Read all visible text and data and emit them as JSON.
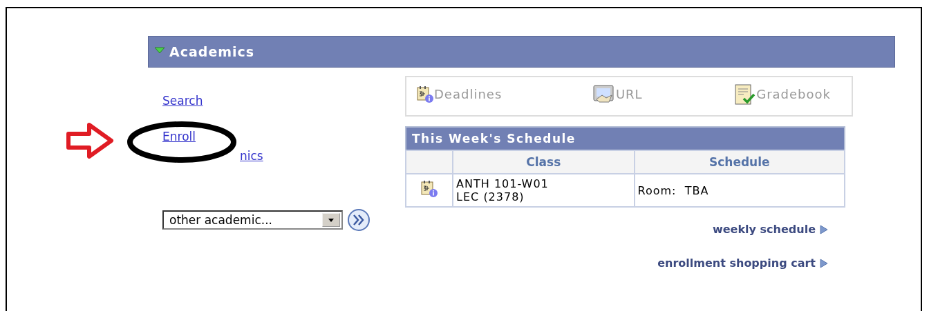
{
  "section": {
    "title": "Academics",
    "expanded": true
  },
  "links": [
    "Search",
    "Enroll",
    "nics"
  ],
  "other_academics": {
    "value": "other academic..."
  },
  "toolbar": [
    {
      "kind": "calendar",
      "label": "Deadlines"
    },
    {
      "kind": "url",
      "label": "URL"
    },
    {
      "kind": "gradebook",
      "label": "Gradebook"
    }
  ],
  "schedule": {
    "title": "This Week's Schedule",
    "columns": [
      "Class",
      "Schedule"
    ],
    "rows": [
      {
        "class_lines": [
          "ANTH 101-W01",
          "LEC (2378)"
        ],
        "schedule": "Room:  TBA"
      }
    ]
  },
  "footer_links": [
    "weekly schedule",
    "enrollment shopping cart"
  ]
}
